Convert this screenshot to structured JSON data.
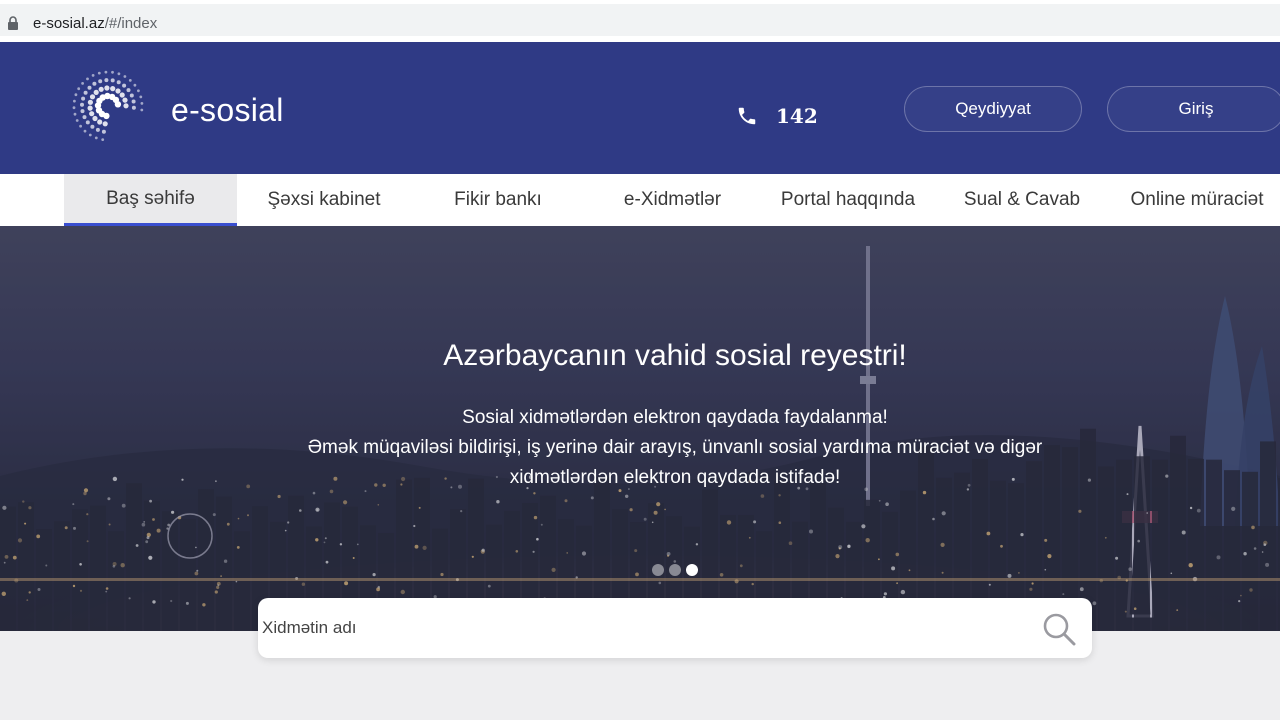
{
  "browser": {
    "url_host": "e-sosial.az",
    "url_path": "/#/index"
  },
  "header": {
    "brand": "e-sosial",
    "phone_number": "142",
    "register_label": "Qeydiyyat",
    "login_label": "Giriş"
  },
  "nav": {
    "items": [
      {
        "label": "Baş səhifə",
        "active": true
      },
      {
        "label": "Şəxsi kabinet"
      },
      {
        "label": "Fikir bankı"
      },
      {
        "label": "e-Xidmətlər"
      },
      {
        "label": "Portal haqqında"
      },
      {
        "label": "Sual & Cavab"
      },
      {
        "label": "Online müraciət"
      }
    ]
  },
  "hero": {
    "title": "Azərbaycanın vahid sosial reyestri!",
    "line1": "Sosial xidmətlərdən elektron qaydada faydalanma!",
    "line2": "Əmək müqaviləsi bildirişi, iş yerinə dair arayış, ünvanlı sosial yardıma müraciət və digər",
    "line3": "xidmətlərdən elektron qaydada istifadə!",
    "slides": 3,
    "active_slide": 3
  },
  "search": {
    "placeholder": "Xidmətin adı"
  },
  "colors": {
    "header_bg": "#2f3a85",
    "nav_active_underline": "#3a4fd0",
    "page_bg": "#eeeef0"
  },
  "icons": {
    "lock": "lock-icon",
    "logo": "e-sosial-logo",
    "phone": "phone-icon",
    "search": "search-icon"
  }
}
